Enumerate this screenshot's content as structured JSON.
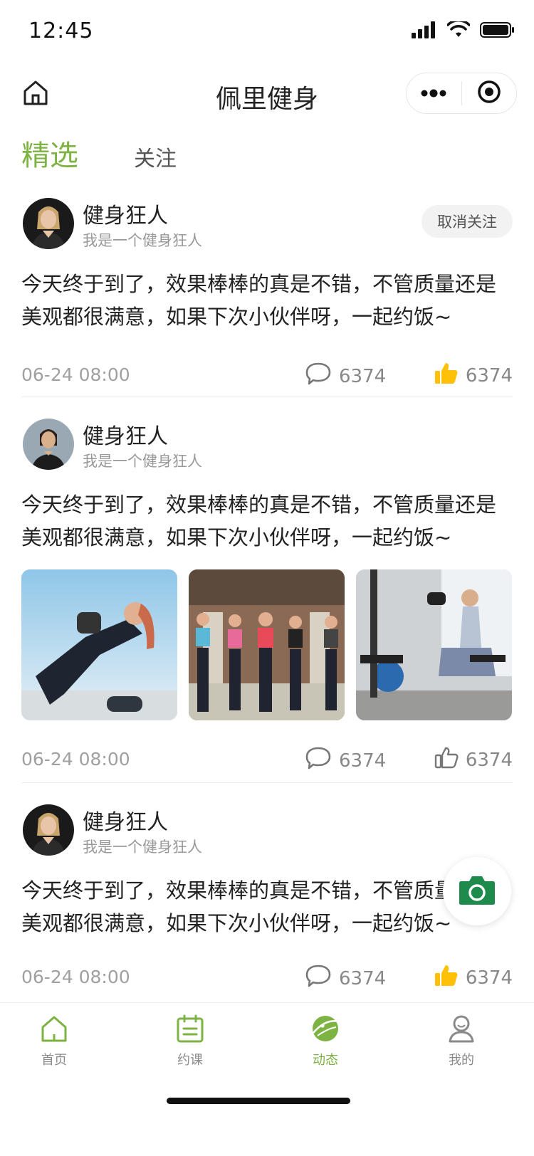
{
  "status_bar": {
    "time": "12:45"
  },
  "nav": {
    "title": "佩里健身"
  },
  "tabs": {
    "active": "精选",
    "inactive": "关注"
  },
  "colors": {
    "accent": "#7cb342",
    "highlight": "#ffc107",
    "like_active": "#ffc107"
  },
  "posts": [
    {
      "author": "健身狂人",
      "bio": "我是一个健身狂人",
      "follow_button": "取消关注",
      "text": "今天终于到了，效果棒棒的真是不错，不管质量还是美观都很满意，如果下次小伙伴呀，一起约饭~",
      "time": "06-24   08:00",
      "comments": "6374",
      "likes": "6374",
      "liked": true
    },
    {
      "author": "健身狂人",
      "bio": "我是一个健身狂人",
      "text": "今天终于到了，效果棒棒的真是不错，不管质量还是美观都很满意，如果下次小伙伴呀，一起约饭~",
      "time": "06-24   08:00",
      "comments": "6374",
      "likes": "6374",
      "liked": false
    },
    {
      "author": "健身狂人",
      "bio": "我是一个健身狂人",
      "text": "今天终于到了，效果棒棒的真是不错，不管质量还是美观都很满意，如果下次小伙伴呀，一起约饭~",
      "time": "06-24   08:00",
      "comments": "6374",
      "likes": "6374",
      "liked": true
    }
  ],
  "tab_bar": {
    "items": [
      {
        "label": "首页",
        "icon": "home-icon"
      },
      {
        "label": "约课",
        "icon": "calendar-icon"
      },
      {
        "label": "动态",
        "icon": "planet-icon"
      },
      {
        "label": "我的",
        "icon": "profile-icon"
      }
    ],
    "active_index": 2
  }
}
